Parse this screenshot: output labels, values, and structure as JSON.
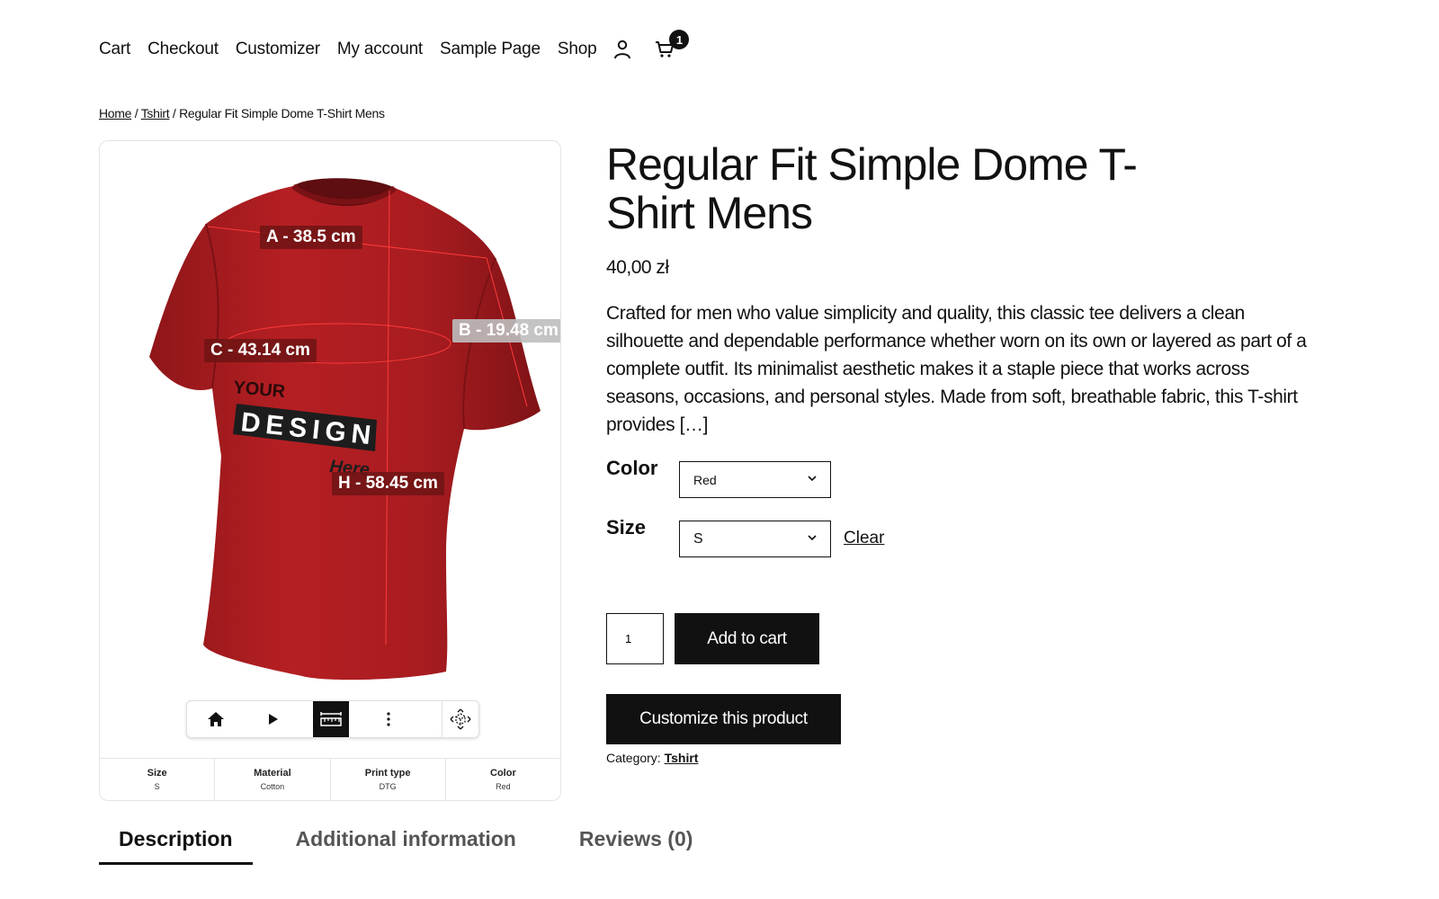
{
  "nav": {
    "links": [
      "Cart",
      "Checkout",
      "Customizer",
      "My account",
      "Sample Page",
      "Shop"
    ],
    "cart_count": "1"
  },
  "breadcrumb": {
    "home": "Home",
    "sep1": " / ",
    "category": "Tshirt",
    "sep2": " / ",
    "current": "Regular Fit Simple Dome T-Shirt Mens"
  },
  "viewer": {
    "measurements": {
      "a": "A - 38.5 cm",
      "b": "B - 19.48 cm",
      "c": "C - 43.14 cm",
      "h": "H - 58.45 cm"
    },
    "print": {
      "line1": "YOUR",
      "line2": "DESIGN",
      "line3": "Here"
    },
    "shirt_color": "#b01e22",
    "toolbar_icons": [
      "home-icon",
      "play-icon",
      "ruler-icon",
      "more-vertical-icon",
      "move-3d-icon"
    ]
  },
  "specs": [
    {
      "title": "Size",
      "value": "S"
    },
    {
      "title": "Material",
      "value": "Cotton"
    },
    {
      "title": "Print type",
      "value": "DTG"
    },
    {
      "title": "Color",
      "value": "Red"
    }
  ],
  "product": {
    "title": "Regular Fit Simple Dome T-Shirt Mens",
    "title_line1": "Regular Fit Simple Dome T-",
    "title_line2": "Shirt Mens",
    "price": "40,00 zł",
    "description": "Crafted for men who value simplicity and quality, this classic tee delivers a clean silhouette and dependable performance whether worn on its own or layered as part of a complete outfit. Its minimalist aesthetic makes it a staple piece that works across seasons, occasions, and personal styles. Made from soft, breathable fabric, this T-shirt provides […]",
    "color_label": "Color",
    "color_value": "Red",
    "size_label": "Size",
    "size_value": "S",
    "clear_label": "Clear",
    "quantity": "1",
    "add_to_cart_label": "Add to cart",
    "customize_label": "Customize this product",
    "category_label": "Category:",
    "category_value": "Tshirt"
  },
  "tabs": [
    "Description",
    "Additional information",
    "Reviews (0)"
  ]
}
